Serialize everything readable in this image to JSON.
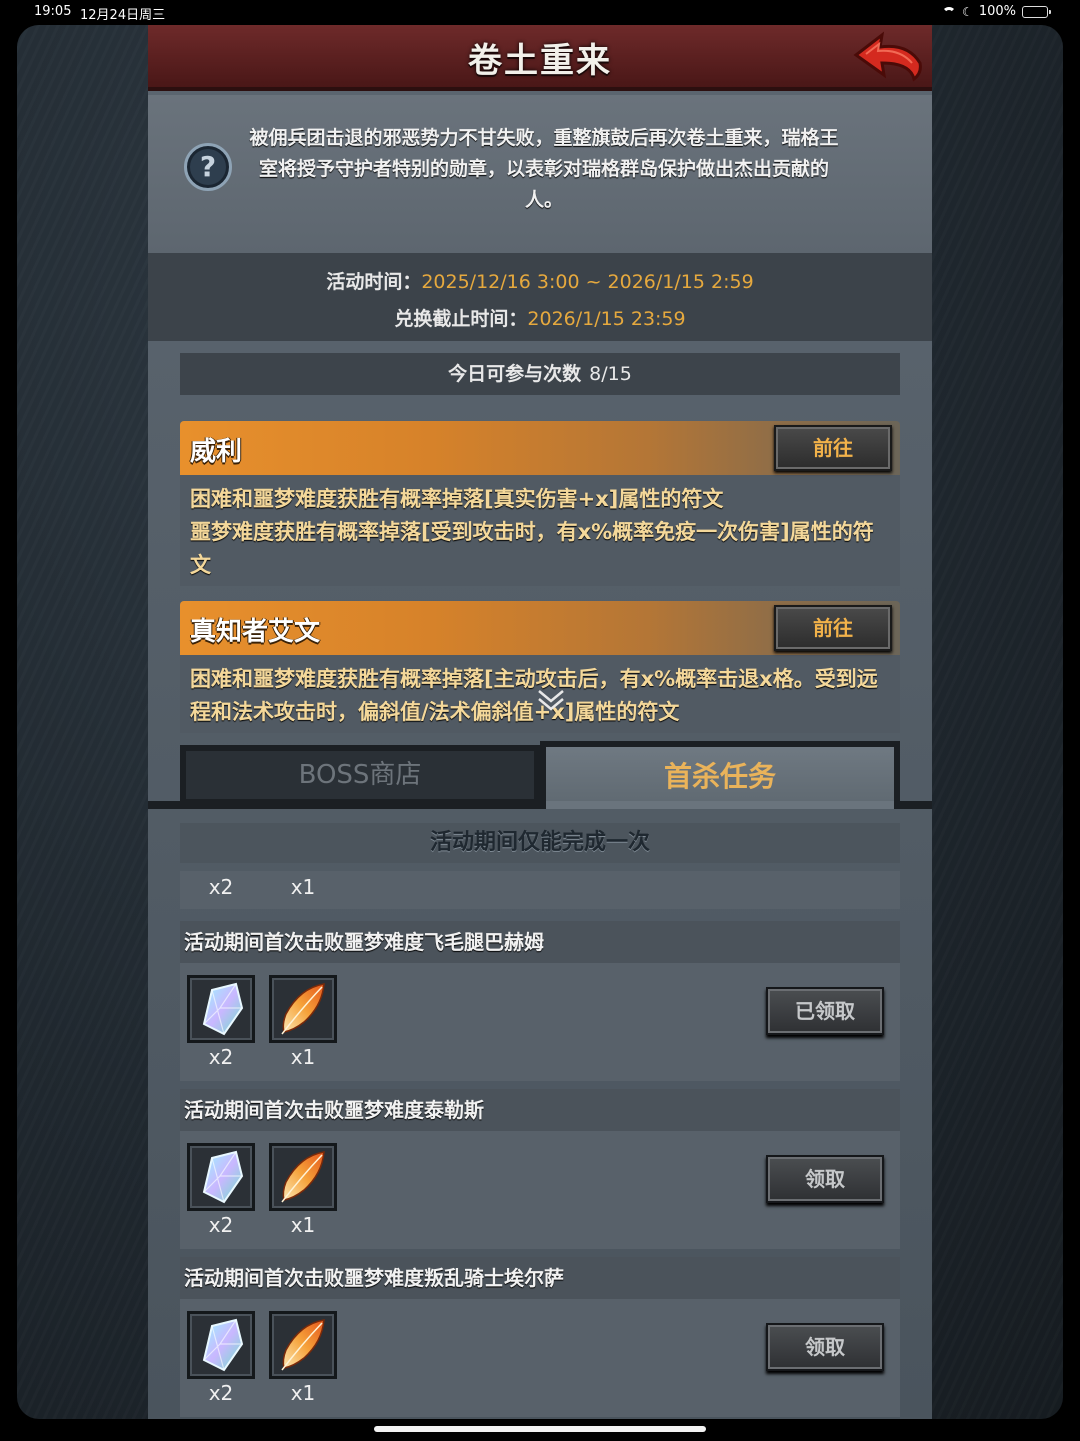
{
  "status_bar": {
    "time": "19:05",
    "date": "12月24日周三",
    "battery": "100%"
  },
  "header": {
    "title": "卷土重来"
  },
  "intro": {
    "text": "被佣兵团击退的邪恶势力不甘失败，重整旗鼓后再次卷土重来，瑞格王室将授予守护者特别的勋章，以表彰对瑞格群岛保护做出杰出贡献的人。"
  },
  "event_time": {
    "activity_label": "活动时间：",
    "activity_value": "2025/12/16 3:00 ~ 2026/1/15 2:59",
    "exchange_label": "兑换截止时间：",
    "exchange_value": "2026/1/15 23:59"
  },
  "daily": {
    "label": "今日可参与次数",
    "value": "8/15"
  },
  "bosses": [
    {
      "name": "威利",
      "button": "前往",
      "desc": "困难和噩梦难度获胜有概率掉落[真实伤害+x]属性的符文\n噩梦难度获胜有概率掉落[受到攻击时，有x%概率免疫一次伤害]属性的符文"
    },
    {
      "name": "真知者艾文",
      "button": "前往",
      "desc": "困难和噩梦难度获胜有概率掉落[主动攻击后，有x%概率击退x格。受到远程和法术攻击时，偏斜值/法术偏斜值+x]属性的符文"
    }
  ],
  "tabs": {
    "shop": "BOSS商店",
    "first_kill": "首杀任务"
  },
  "task_header": "活动期间仅能完成一次",
  "partial_row": {
    "qty1": "x2",
    "qty2": "x1"
  },
  "tasks": [
    {
      "title": "活动期间首次击败噩梦难度飞毛腿巴赫姆",
      "qty1": "x2",
      "qty2": "x1",
      "button": "已领取"
    },
    {
      "title": "活动期间首次击败噩梦难度泰勒斯",
      "qty1": "x2",
      "qty2": "x1",
      "button": "领取"
    },
    {
      "title": "活动期间首次击败噩梦难度叛乱骑士埃尔萨",
      "qty1": "x2",
      "qty2": "x1",
      "button": "领取"
    }
  ],
  "icons": {
    "help": "question-icon",
    "back": "back-arrow-icon",
    "reward1": "crystal-icon",
    "reward2": "feather-icon",
    "scroll": "chevron-down-icon"
  },
  "colors": {
    "accent": "#e6a93e",
    "title_bar": "#6e2a2a",
    "boss_header": "#e8902c",
    "button_text": "#f2b24a"
  }
}
